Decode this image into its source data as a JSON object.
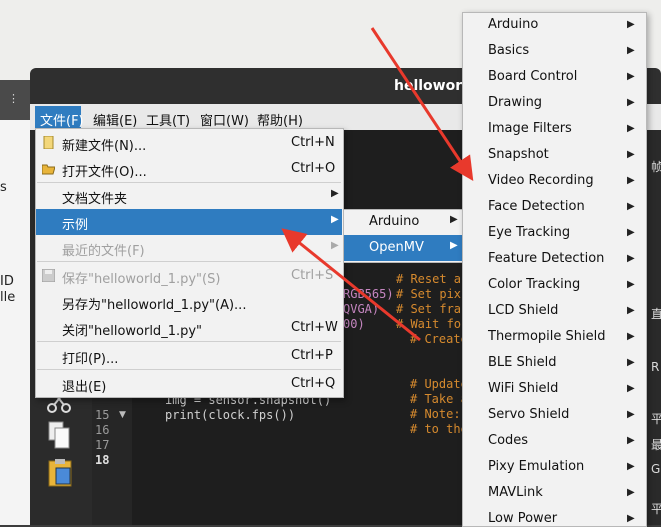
{
  "window": {
    "title": "helloworld"
  },
  "background_fragments": [
    "s",
    "ID",
    "lle"
  ],
  "menubar": [
    {
      "label": "文件(F)"
    },
    {
      "label": "编辑(E)"
    },
    {
      "label": "工具(T)"
    },
    {
      "label": "窗口(W)"
    },
    {
      "label": "帮助(H)"
    }
  ],
  "file_menu": {
    "items": [
      {
        "label": "新建文件(N)...",
        "shortcut": "Ctrl+N",
        "icon": "new-file-icon"
      },
      {
        "label": "打开文件(O)...",
        "shortcut": "Ctrl+O",
        "icon": "open-folder-icon"
      },
      {
        "label": "文档文件夹",
        "shortcut": ""
      },
      {
        "label": "示例",
        "shortcut": ""
      },
      {
        "label": "最近的文件(F)",
        "shortcut": ""
      },
      {
        "label": "保存\"helloworld_1.py\"(S)",
        "shortcut": "Ctrl+S",
        "icon": "save-icon"
      },
      {
        "label": "另存为\"helloworld_1.py\"(A)...",
        "shortcut": ""
      },
      {
        "label": "关闭\"helloworld_1.py\"",
        "shortcut": "Ctrl+W"
      },
      {
        "label": "打印(P)...",
        "shortcut": "Ctrl+P"
      },
      {
        "label": "退出(E)",
        "shortcut": "Ctrl+Q"
      }
    ]
  },
  "examples_submenu": [
    {
      "label": "Arduino"
    },
    {
      "label": "OpenMV"
    }
  ],
  "openmv_submenu": [
    "Arduino",
    "Basics",
    "Board Control",
    "Drawing",
    "Image Filters",
    "Snapshot",
    "Video Recording",
    "Face Detection",
    "Eye Tracking",
    "Feature Detection",
    "Color Tracking",
    "LCD Shield",
    "Thermopile Shield",
    "BLE Shield",
    "WiFi Shield",
    "Servo Shield",
    "Codes",
    "Pixy Emulation",
    "MAVLink",
    "Low Power"
  ],
  "editor": {
    "line_numbers": [
      "15",
      "16",
      "17",
      "18"
    ],
    "code_lines": [
      {
        "code": "",
        "comment": "# Reset a"
      },
      {
        "code": "RGB565)",
        "comment": "# Set pix"
      },
      {
        "code": "QVGA)",
        "comment": "# Set fra"
      },
      {
        "code": "00)",
        "comment": "# Wait fo"
      },
      {
        "code": "",
        "comment": "# Create"
      },
      {
        "code": "",
        "comment": "# Update"
      },
      {
        "code": "img = sensor.snapshot()",
        "comment": "# Take a"
      },
      {
        "code": "print(clock.fps())",
        "comment": "# Note: O"
      },
      {
        "code": "",
        "comment": "# to the"
      }
    ]
  },
  "right_strip": [
    "帧",
    "直",
    "R",
    "平",
    "最",
    "G",
    "平"
  ],
  "colors": {
    "selection": "#2f7cc0",
    "comment": "#d68a2e",
    "annotation_arrow": "#e8392c"
  }
}
